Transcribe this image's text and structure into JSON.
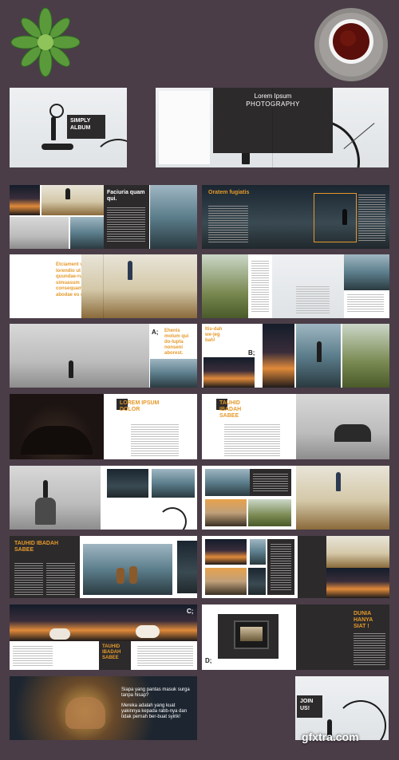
{
  "colors": {
    "background": "#4a3d47",
    "accent": "#e59a2b",
    "dark_panel": "#2c2a2b"
  },
  "decor": {
    "plant": "succulent-plant",
    "cup": "coffee-cup"
  },
  "headings": {
    "simply_album": "SIMPLY ALBUM",
    "lorem_ipsum": "Lorem Ipsum",
    "photography": "PHOTOGRAPHY",
    "faciuria": "Faciuria quam qui.",
    "oratem": "Oratem fugiatis",
    "etciament": "Etciament vo-lorendio ut quat quundae-runt, simuasum consequam volor abodae es doluptas.",
    "letter_a": "A;",
    "ehenis": "Ehenis molum qui do-lupta nonseni aborest.",
    "itis": "Itis-dah we-jeg bah!",
    "letter_b": "B;",
    "lorem_ipsum_dolor": "LOREM IPSUM DOLOR",
    "tauhid_sabee_1": "TAUHID IBADAH SABEE",
    "tauhid_sabee_2": "TAUHID IBADAH SABEE",
    "tauhid_sabee_3": "TAUHID IBADAH SABEE",
    "letter_c": "C;",
    "letter_d": "D;",
    "dunia": "DUNIA HANYA SIAT !",
    "quote_1": "Siapa yang pantas masuk surga tanpa hisap?",
    "quote_2": "Mereka adalah yang kuat yakinnya kepada rabb-nya dan tidak pernah ber-buat syirik!",
    "join_us": "JOIN US!"
  },
  "watermark": "gfxtra.com"
}
